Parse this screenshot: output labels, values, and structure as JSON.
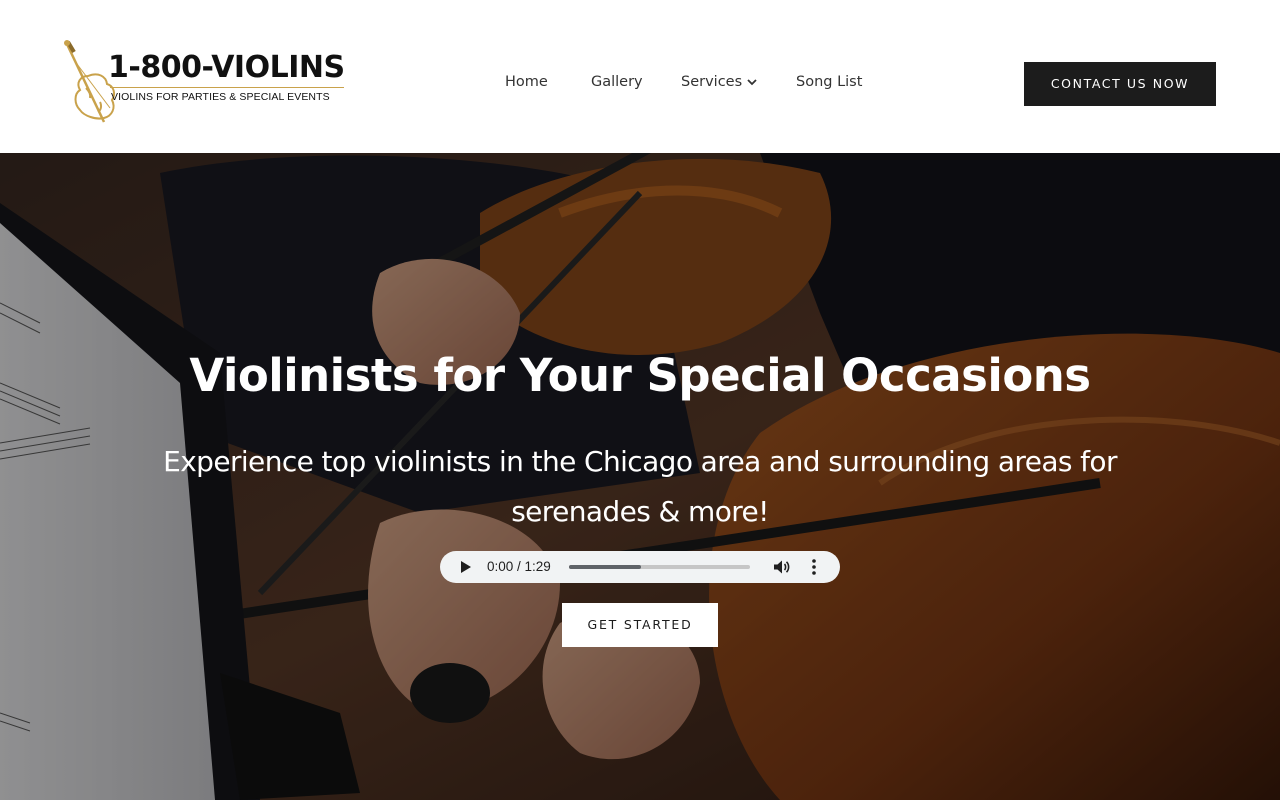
{
  "brand": {
    "name": "1-800-VIOLINS",
    "tagline": "VIOLINS FOR PARTIES & SPECIAL EVENTS",
    "accent_color": "#c9a24b"
  },
  "nav": {
    "home": "Home",
    "gallery": "Gallery",
    "services": "Services",
    "song_list": "Song List"
  },
  "header": {
    "contact_label": "CONTACT US NOW"
  },
  "hero": {
    "title": "Violinists for Your Special Occasions",
    "subtitle": "Experience top violinists in the Chicago area and surrounding areas for serenades & more!",
    "cta_label": "GET STARTED",
    "background": "violinists playing photograph"
  },
  "audio_player": {
    "time": "0:00 / 1:29",
    "buffered_fraction": 0.4
  },
  "icons": {
    "logo": "violin-icon",
    "services_menu": "chevron-down-icon",
    "play": "play-icon",
    "volume": "volume-icon",
    "more": "more-vertical-icon"
  }
}
